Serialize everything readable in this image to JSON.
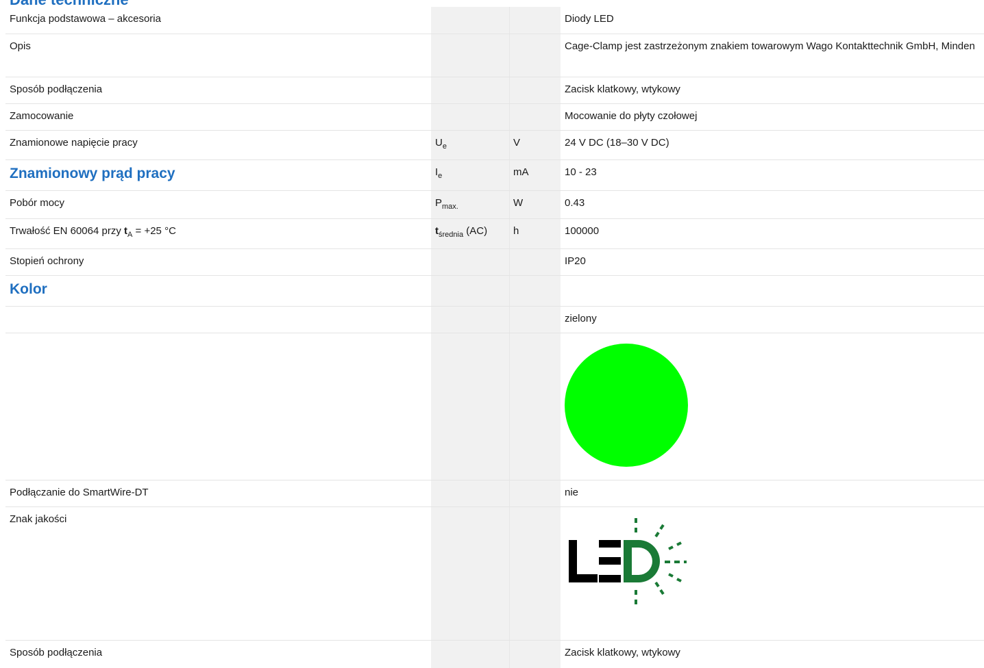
{
  "top_heading_partial": "Dane techniczne",
  "rows": [
    {
      "label": "Funkcja podstawowa – akcesoria",
      "value": "Diody LED"
    },
    {
      "label": "Opis",
      "value": "Cage-Clamp jest zastrzeżonym znakiem towarowym Wago Kontakttechnik GmbH, Minden"
    },
    {
      "label": "Sposób podłączenia",
      "value": "Zacisk klatkowy, wtykowy"
    },
    {
      "label": "Zamocowanie",
      "value": "Mocowanie do płyty czołowej"
    },
    {
      "label": "Znamionowe napięcie pracy",
      "symbol": "U",
      "symbol_sub": "e",
      "unit": "V",
      "value": "24 V DC (18–30 V DC)"
    },
    {
      "label": "Znamionowy prąd pracy",
      "symbol": "I",
      "symbol_sub": "e",
      "unit": "mA",
      "value": "10 - 23"
    },
    {
      "label": "Pobór mocy",
      "symbol": "P",
      "symbol_sub": "max.",
      "unit": "W",
      "value": "0.43"
    },
    {
      "label_pre": "Trwałość EN 60064 przy ",
      "label_bold": "t",
      "label_sub": "A",
      "label_post": " = +25 °C",
      "symbol_bold": "t",
      "symbol_sub": "średnia",
      "symbol_post": " (AC)",
      "unit": "h",
      "value": "100000"
    },
    {
      "label": "Stopień ochrony",
      "value": "IP20"
    },
    {
      "label": "Kolor"
    },
    {
      "value": "zielony"
    },
    {
      "label": "Podłączanie do SmartWire-DT",
      "value": "nie"
    },
    {
      "label": "Znak jakości"
    },
    {
      "label": "Sposób podłączenia",
      "value": "Zacisk klatkowy, wtykowy"
    }
  ],
  "colors": {
    "swatch": "#00ff00",
    "heading": "#1f6fc0",
    "logo_green": "#1a7a36",
    "logo_black": "#000000"
  },
  "icons": {
    "quality_mark": "led-logo-icon"
  }
}
